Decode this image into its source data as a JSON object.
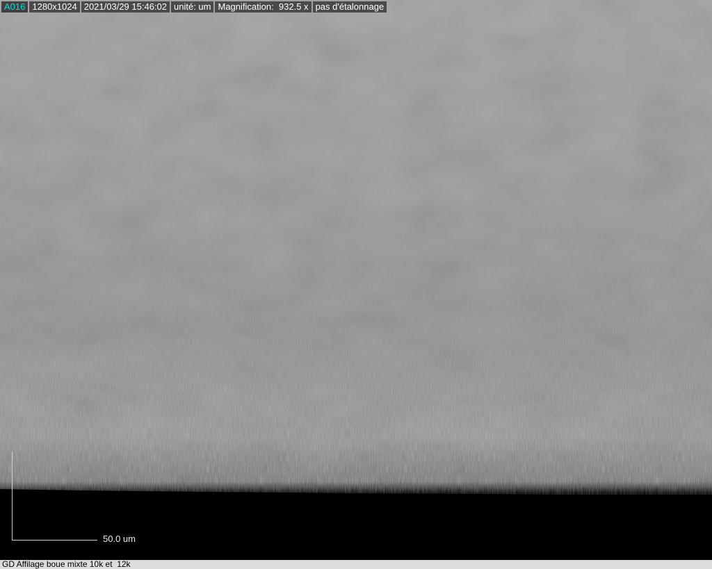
{
  "info_bar": {
    "image_id": "A016",
    "resolution": "1280x1024",
    "datetime": "2021/03/29 15:46:02",
    "unit": "unité: um",
    "magnification": "Magnification:  932.5 x",
    "calibration": "pas d'étalonnage"
  },
  "image": {
    "description_icon": "microscope-image",
    "colors": {
      "background_top": "#a8a8a8",
      "edge_dark": "#000000",
      "id_accent": "#00e0e0"
    }
  },
  "scale_bar": {
    "label": "50.0 um"
  },
  "caption": {
    "text": "GD Affilage boue mixte 10k et  12k"
  }
}
